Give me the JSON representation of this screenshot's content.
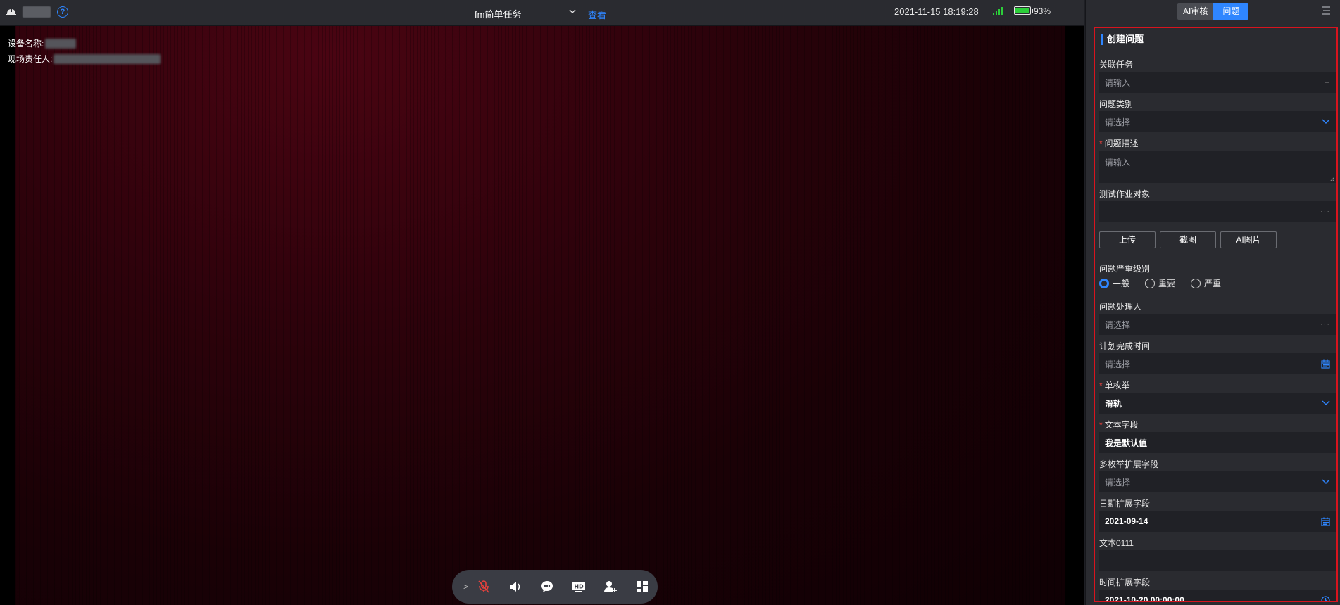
{
  "topbar": {
    "task_name": "fm简单任务",
    "view_link": "查看",
    "datetime": "2021-11-15 18:19:28",
    "battery": "93%",
    "battery_level": 0.93,
    "colors": {
      "accent": "#2f86ff",
      "battery": "#2ccf3a",
      "signal": "#2ccf3a"
    }
  },
  "video": {
    "device_label": "设备名称:",
    "responsible_label": "现场责任人:",
    "controls": [
      "mic-muted-icon",
      "speaker-icon",
      "chat-icon",
      "hd-icon",
      "add-user-icon",
      "layout-icon"
    ]
  },
  "panel": {
    "tabs": {
      "ai_review": "AI审核",
      "issue": "问题"
    },
    "form_title": "创建问题",
    "fields": {
      "linked_task": {
        "label": "关联任务",
        "placeholder": "请输入"
      },
      "category": {
        "label": "问题类别",
        "placeholder": "请选择"
      },
      "description": {
        "label": "问题描述",
        "placeholder": "请输入",
        "required": true
      },
      "test_object": {
        "label": "测试作业对象",
        "value": ""
      },
      "severity": {
        "label": "问题严重级别",
        "options": [
          "一般",
          "重要",
          "严重"
        ],
        "selected": "一般"
      },
      "handler": {
        "label": "问题处理人",
        "placeholder": "请选择"
      },
      "planned_time": {
        "label": "计划完成时间",
        "placeholder": "请选择"
      },
      "single_enum": {
        "label": "单枚举",
        "value": "滑轨",
        "required": true
      },
      "text_field": {
        "label": "文本字段",
        "value": "我是默认值",
        "required": true
      },
      "multi_enum": {
        "label": "多枚举扩展字段",
        "placeholder": "请选择"
      },
      "date_field": {
        "label": "日期扩展字段",
        "value": "2021-09-14"
      },
      "text0111": {
        "label": "文本0111",
        "value": ""
      },
      "time_field": {
        "label": "时间扩展字段",
        "value": "2021-10-20 00:00:00"
      }
    },
    "buttons": {
      "upload": "上传",
      "screenshot": "截图",
      "ai_image": "AI图片"
    },
    "colors": {
      "highlight_border": "#d8141e",
      "required": "#e8413c"
    }
  }
}
